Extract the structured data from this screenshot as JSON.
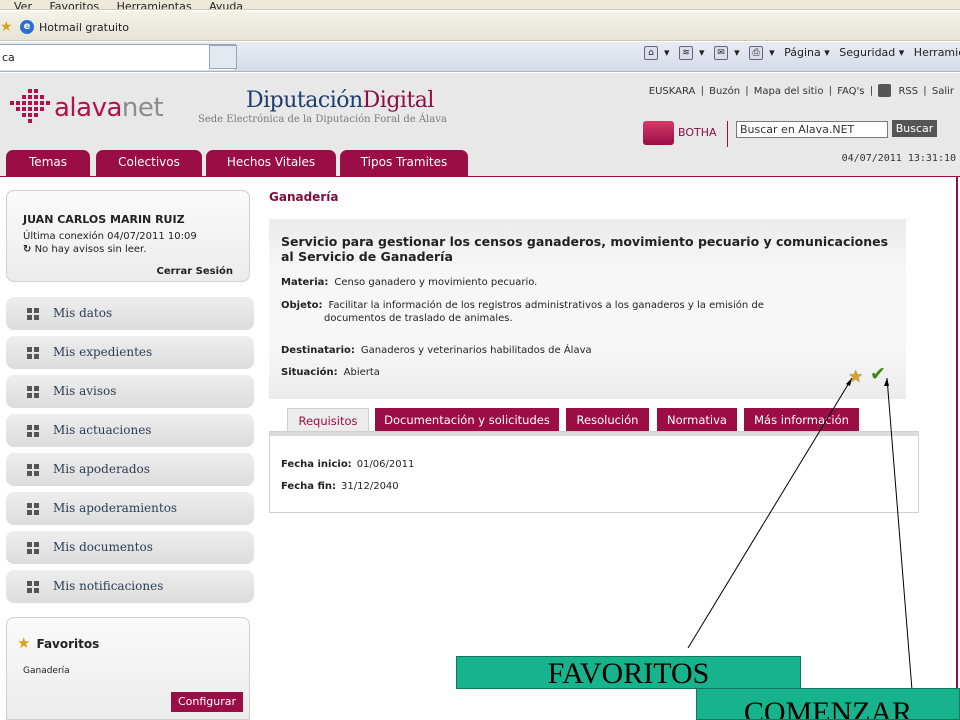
{
  "browser": {
    "menu_items": [
      "Ver",
      "Favoritos",
      "Herramientas",
      "Ayuda"
    ],
    "favorites_item": "Hotmail gratuito",
    "tab_label": "ca",
    "toolbar": [
      "Página ▾",
      "Seguridad ▾",
      "Herramie"
    ]
  },
  "header": {
    "brand_alava": "alava",
    "brand_net": "net",
    "dipu_title_a": "Diputación",
    "dipu_title_b": "Digital",
    "dipu_subtitle": "Sede Electrónica de la Diputación Foral de Álava",
    "links": [
      "EUSKARA",
      "Buzón",
      "Mapa del sitio",
      "FAQ's",
      "RSS",
      "Salir"
    ],
    "botha_label": "BOTHA",
    "search_value": "Buscar en Alava.NET",
    "search_button": "Buscar",
    "nav_tabs": [
      "Temas",
      "Colectivos",
      "Hechos Vitales",
      "Tipos Tramites"
    ],
    "datetime": "04/07/2011 13:31:10"
  },
  "user": {
    "name": "JUAN CARLOS MARIN RUIZ",
    "last_login": "Última conexión 04/07/2011 10:09",
    "notices": "No hay avisos sin leer.",
    "logout": "Cerrar Sesión"
  },
  "menu": [
    "Mis datos",
    "Mis expedientes",
    "Mis avisos",
    "Mis actuaciones",
    "Mis apoderados",
    "Mis apoderamientos",
    "Mis documentos",
    "Mis notificaciones"
  ],
  "favorites": {
    "title": "Favoritos",
    "items": [
      "Ganadería"
    ],
    "configure": "Configurar"
  },
  "content": {
    "section": "Ganadería",
    "service_title": "Servicio para gestionar los censos ganaderos, movimiento pecuario y comunicaciones al Servicio de Ganadería",
    "materia_label": "Materia:",
    "materia": "Censo ganadero y movimiento pecuario.",
    "objeto_label": "Objeto:",
    "objeto_a": "Facilitar la información de los registros administrativos a los ganaderos y la emisión de",
    "objeto_b": "documentos de traslado de animales.",
    "destinatario_label": "Destinatario:",
    "destinatario": "Ganaderos y veterinarios habilitados de Álava",
    "situacion_label": "Situación:",
    "situacion": "Abierta",
    "tabs": [
      "Requisitos",
      "Documentación y solicitudes",
      "Resolución",
      "Normativa",
      "Más información"
    ],
    "active_tab": "Requisitos",
    "fecha_inicio_label": "Fecha inicio:",
    "fecha_inicio": "01/06/2011",
    "fecha_fin_label": "Fecha fin:",
    "fecha_fin": "31/12/2040"
  },
  "annotations": {
    "favoritos": "FAVORITOS",
    "comenzar": "COMENZAR",
    "color": "#16b38c"
  },
  "colors": {
    "brand": "#9a0d45",
    "header_bg": "#e8e8e8"
  }
}
